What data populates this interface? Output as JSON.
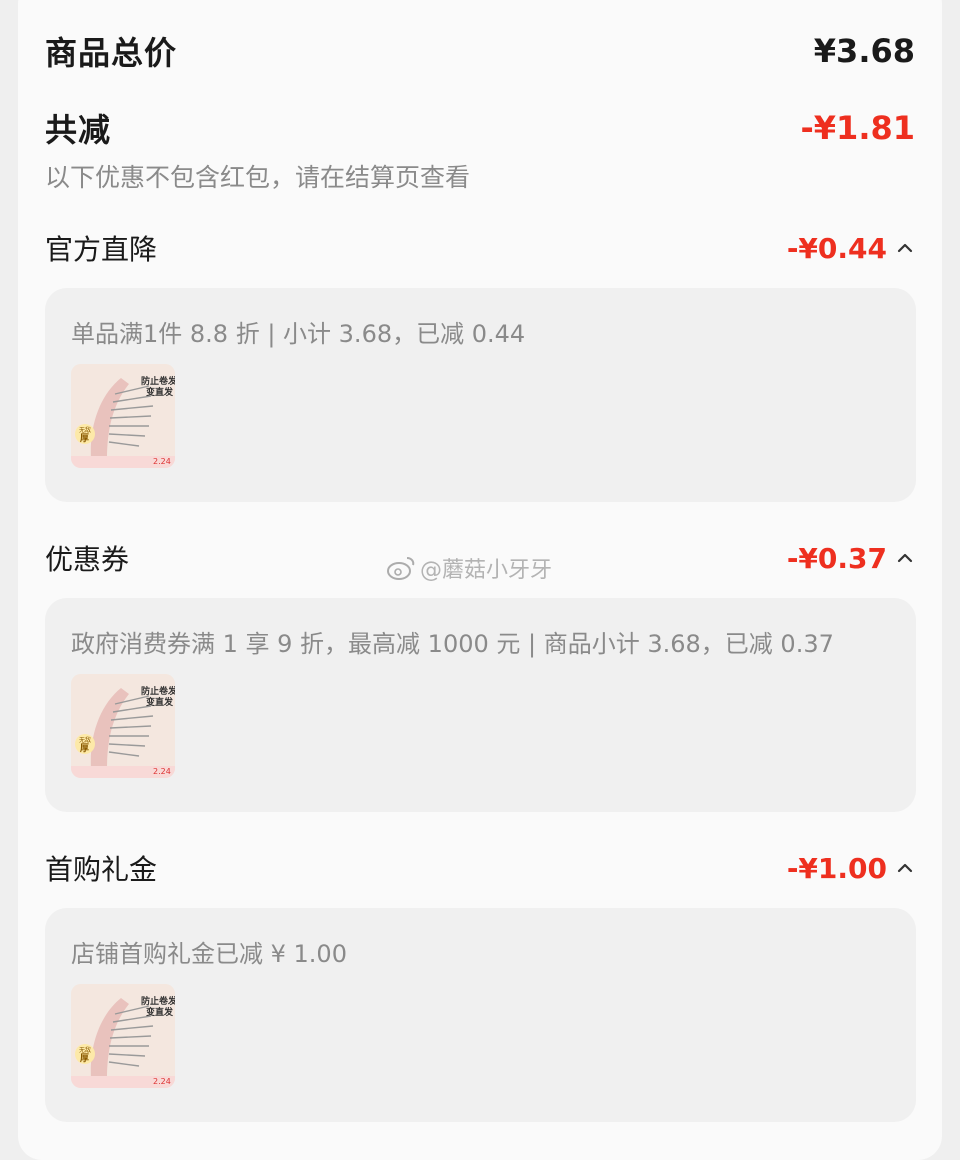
{
  "summary": {
    "total_label": "商品总价",
    "total_value": "¥3.68",
    "reduce_label": "共减",
    "reduce_value": "-¥1.81",
    "note": "以下优惠不包含红包，请在结算页查看"
  },
  "sections": [
    {
      "title": "官方直降",
      "amount": "-¥0.44",
      "detail": "单品满1件 8.8 折 | 小计 3.68，已减 0.44",
      "thumb": {
        "headline": "防止卷发",
        "headline2": "变直发",
        "badge": "无敌",
        "badge2": "厚",
        "price": "2.24"
      }
    },
    {
      "title": "优惠券",
      "amount": "-¥0.37",
      "detail": "政府消费券满 1 享 9 折，最高减 1000 元 | 商品小计 3.68，已减 0.37",
      "thumb": {
        "headline": "防止卷发",
        "headline2": "变直发",
        "badge": "无敌",
        "badge2": "厚",
        "price": "2.24"
      }
    },
    {
      "title": "首购礼金",
      "amount": "-¥1.00",
      "detail": "店铺首购礼金已减 ¥ 1.00",
      "thumb": {
        "headline": "防止卷发",
        "headline2": "变直发",
        "badge": "无敌",
        "badge2": "厚",
        "price": "2.24"
      }
    }
  ],
  "watermark": "@蘑菇小牙牙",
  "colors": {
    "accent_red": "#ee2f1f",
    "card_bg": "#f0f0f0",
    "muted_text": "#8a8a8a"
  },
  "icons": {
    "expand": "chevron-up-icon",
    "watermark": "weibo-icon"
  }
}
